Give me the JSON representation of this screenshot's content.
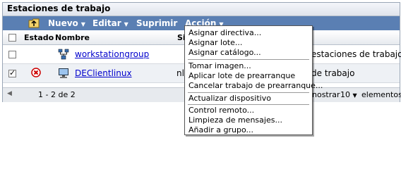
{
  "panel": {
    "title": "Estaciones de trabajo"
  },
  "toolbar": {
    "nuevo": "Nuevo",
    "editar": "Editar",
    "suprimir": "Suprimir",
    "accion": "Acción"
  },
  "table": {
    "col_estado": "Estado",
    "col_nombre": "Nombre",
    "col_cut": "Si",
    "rows": [
      {
        "name": "workstationgroup",
        "tail": "estaciones de trabajo",
        "checked": false
      },
      {
        "name": "DEClientlinux",
        "prefix": "nl",
        "tail": "de trabajo",
        "checked": true
      }
    ]
  },
  "footer": {
    "range": "1 - 2 de 2",
    "show_label": "nostrar",
    "show_count": "10",
    "items_label": "elementos"
  },
  "menu": {
    "items": [
      "Asignar directiva...",
      "Asignar lote...",
      "Asignar catálogo...",
      "Tomar imagen...",
      "Aplicar lote de prearranque",
      "Cancelar trabajo de prearranque...",
      "Actualizar dispositivo",
      "Control remoto...",
      "Limpieza de mensajes...",
      "Añadir a grupo..."
    ]
  },
  "colors": {
    "toolbar": "#5a7fb3",
    "link": "#0000cc"
  }
}
